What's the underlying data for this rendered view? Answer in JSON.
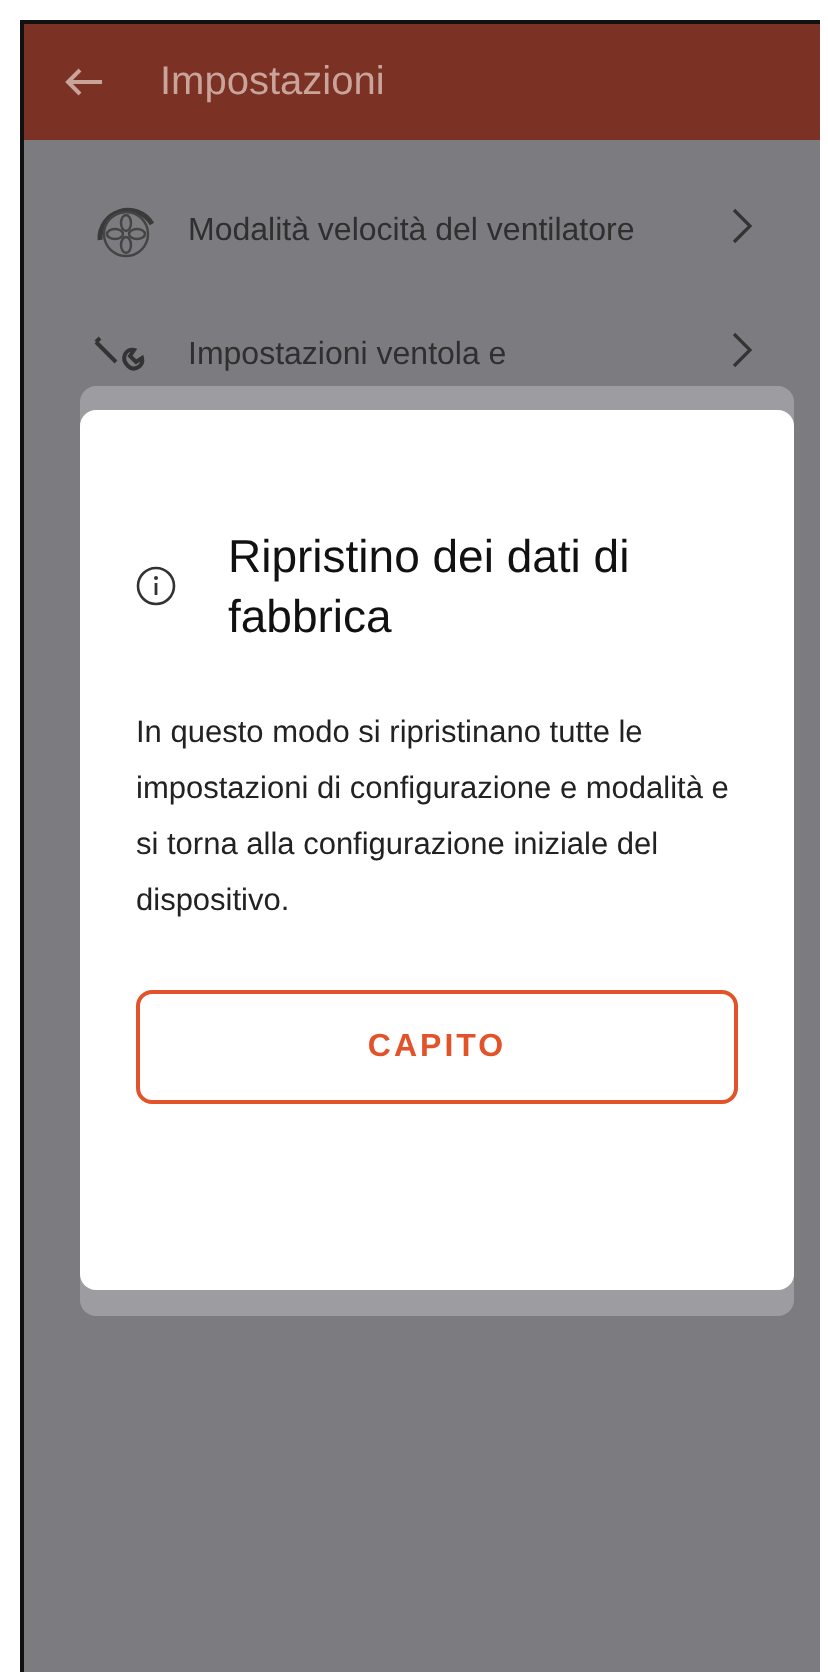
{
  "app_bar": {
    "title": "Impostazioni"
  },
  "settings_items": [
    {
      "kind": "fan-speed",
      "label": "Modalità velocità del ventilatore"
    },
    {
      "kind": "tools",
      "label": "Impostazioni ventola e"
    }
  ],
  "dialog": {
    "title": "Ripristino dei dati di fabbrica",
    "message": "In questo modo si ripristinano tutte le impostazioni di configurazione e modalità e si torna alla configurazione iniziale del dispositivo.",
    "button": "CAPITO"
  }
}
